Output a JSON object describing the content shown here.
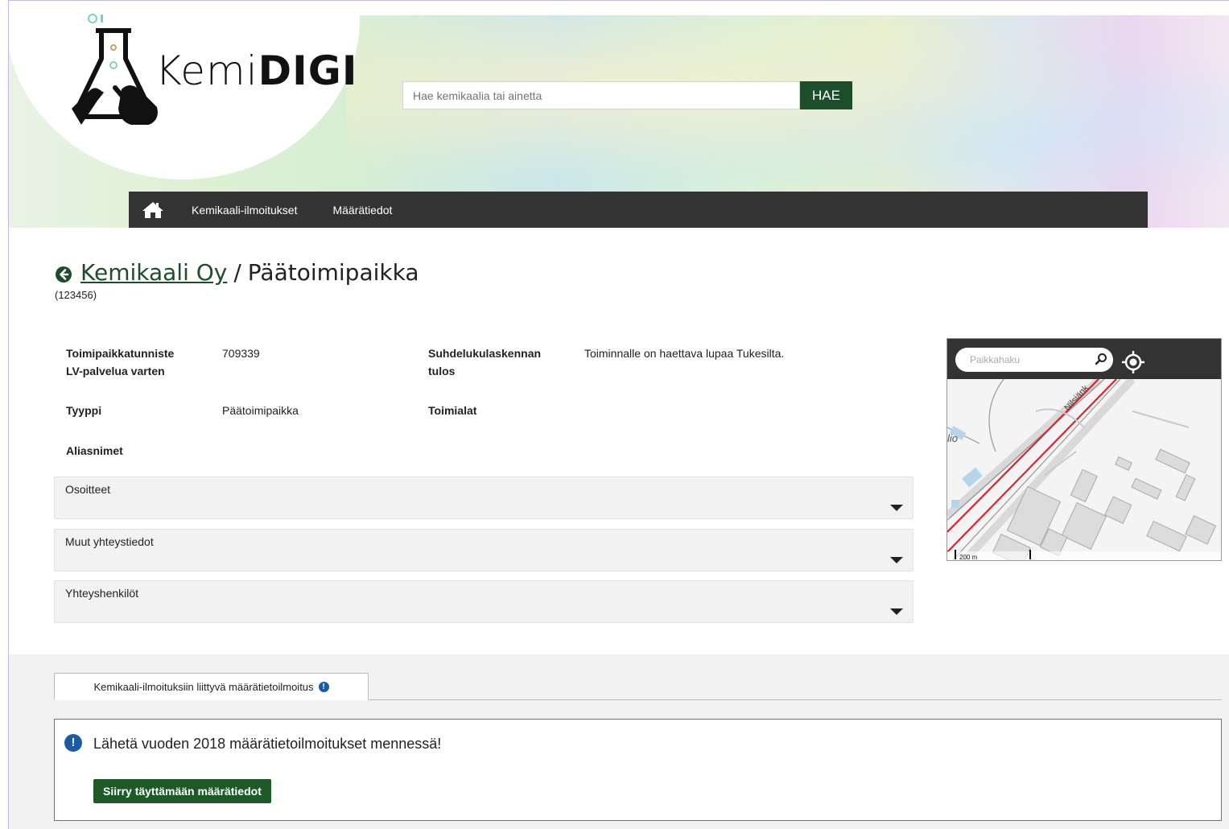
{
  "header": {
    "logo_text_light": "Kemi",
    "logo_text_bold": "DIGI",
    "search_placeholder": "Hae kemikaalia tai ainetta",
    "search_button": "HAE"
  },
  "nav": {
    "home_icon": "home-icon",
    "items": [
      {
        "label": "Kemikaali-ilmoitukset"
      },
      {
        "label": "Määrätiedot"
      }
    ]
  },
  "title": {
    "company": "Kemikaali Oy",
    "separator": "/",
    "site": "Päätoimipaikka",
    "id": "(123456)"
  },
  "details": {
    "toimipaikkatunniste_label": "Toimipaikkatunniste LV-palvelua varten",
    "toimipaikkatunniste_value": "709339",
    "suhdeluku_label": "Suhdelukulaskennan tulos",
    "suhdeluku_value": "Toiminnalle on haettava lupaa Tukesilta.",
    "tyyppi_label": "Tyyppi",
    "tyyppi_value": "Päätoimipaikka",
    "toimialat_label": "Toimialat",
    "aliasnimet_label": "Aliasnimet"
  },
  "accordions": [
    {
      "label": "Osoitteet"
    },
    {
      "label": "Muut yhteystiedot"
    },
    {
      "label": "Yhteyshenkilöt"
    }
  ],
  "map": {
    "search_placeholder": "Paikkahaku",
    "scale_label": "200 m",
    "street_label": "Nilsiänk",
    "area_label": "lio"
  },
  "tab": {
    "label": "Kemikaali-ilmoituksiin liittyvä määrätietoilmoitus",
    "info_icon": "!"
  },
  "notice": {
    "icon": "!",
    "text": "Lähetä vuoden 2018 määrätietoilmoitukset mennessä!",
    "button": "Siirry täyttämään määrätiedot"
  },
  "colors": {
    "brand_green": "#1e4d2b",
    "nav_dark": "#333333",
    "info_blue": "#1a5ba6",
    "notice_border": "#2f8c96"
  }
}
